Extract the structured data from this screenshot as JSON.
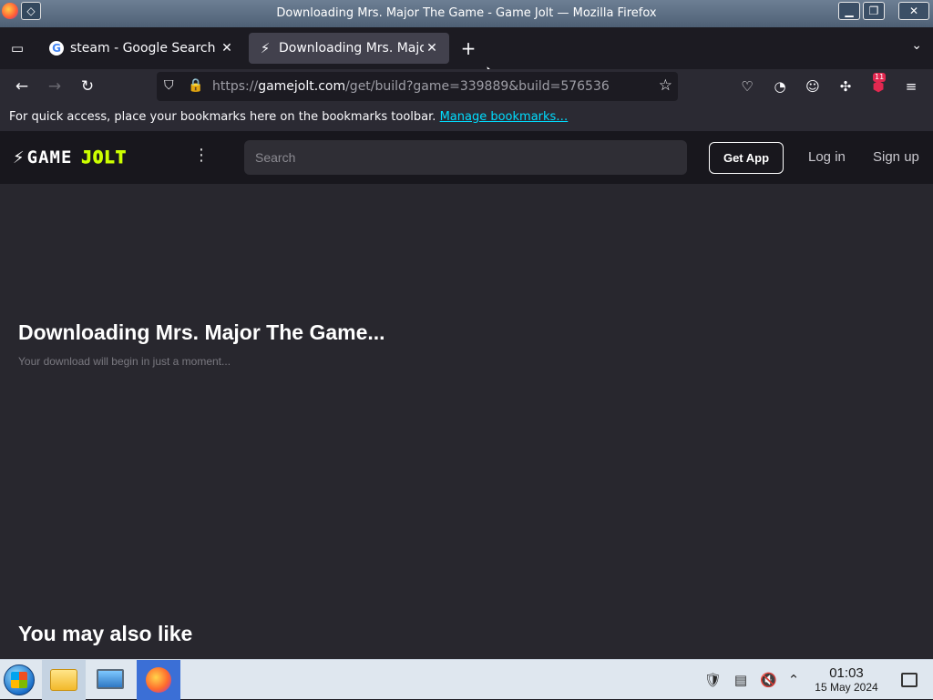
{
  "window": {
    "title": "Downloading Mrs. Major The Game - Game Jolt — Mozilla Firefox",
    "pin_icon": "◇",
    "minimize_icon": "▁",
    "maximize_icon": "❐",
    "close_icon": "✕"
  },
  "tabs": [
    {
      "label": "steam - Google Search",
      "favicon": "G",
      "close": "✕"
    },
    {
      "label": "Downloading Mrs. Major",
      "favicon": "⚡",
      "close": "✕"
    }
  ],
  "tabstrip": {
    "list_tabs_icon": "▭",
    "new_tab_icon": "+",
    "list_all_icon": "⌄"
  },
  "nav": {
    "back_icon": "←",
    "forward_icon": "→",
    "reload_icon": "↻",
    "url_scheme": "https://",
    "url_host": "gamejolt.com",
    "url_path": "/get/build?game=339889&build=576536",
    "shield_icon": "⛉",
    "lock_icon": "🔒",
    "star_icon": "☆",
    "pocket_icon": "♡",
    "firefox_view_icon": "◔",
    "account_icon": "☺",
    "extensions_icon": "✣",
    "addon_icon": "⬢",
    "addon_badge": "11",
    "menu_icon": "≡"
  },
  "bookmarks": {
    "text": "For quick access, place your bookmarks here on the bookmarks toolbar.",
    "link": "Manage bookmarks…"
  },
  "site": {
    "logo_bolt": "⚡",
    "logo_game": "GAME",
    "logo_jolt": "JOLT",
    "kebab_icon": "⋮",
    "search_placeholder": "Search",
    "get_app": "Get App",
    "login": "Log in",
    "signup": "Sign up"
  },
  "main": {
    "heading": "Downloading Mrs. Major The Game...",
    "sub": "Your download will begin in just a moment...",
    "also": "You may also like"
  },
  "taskbar": {
    "tray_icons": [
      "🛡",
      "▤",
      "🔇",
      "⌃"
    ],
    "time": "01:03",
    "date": "15 May 2024"
  }
}
